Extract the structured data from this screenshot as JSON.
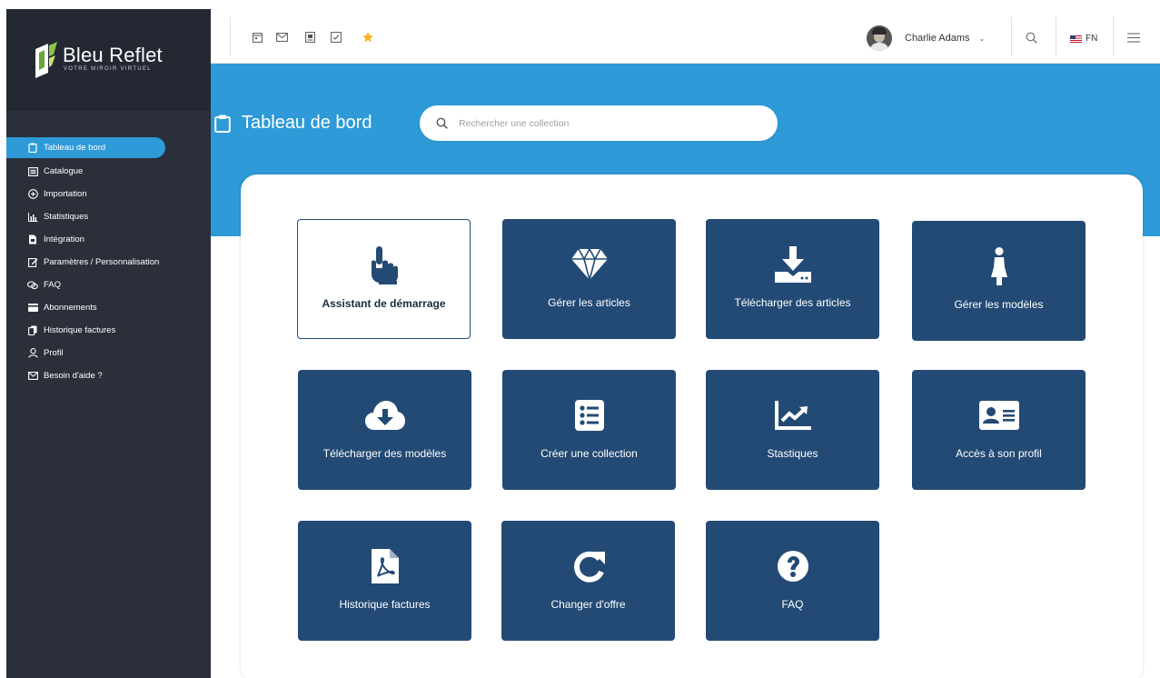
{
  "brand": {
    "name": "Bleu Reflet",
    "tagline": "VOTRE MIROIR VIRTUEL"
  },
  "sidebar": {
    "items": [
      {
        "label": "Tableau de bord",
        "icon": "clipboard-icon",
        "active": true
      },
      {
        "label": "Catalogue",
        "icon": "catalog-icon"
      },
      {
        "label": "Importation",
        "icon": "import-icon"
      },
      {
        "label": "Statistiques",
        "icon": "bar-chart-icon"
      },
      {
        "label": "Intégration",
        "icon": "document-icon"
      },
      {
        "label": "Paramètres / Personnalisation",
        "icon": "edit-icon"
      },
      {
        "label": "FAQ",
        "icon": "chat-icon"
      },
      {
        "label": "Abonnements",
        "icon": "credit-card-icon"
      },
      {
        "label": "Historique factures",
        "icon": "copy-icon"
      },
      {
        "label": "Profil",
        "icon": "user-icon"
      },
      {
        "label": "Besoin d'aide ?",
        "icon": "mail-icon"
      }
    ]
  },
  "topbar": {
    "user_name": "Charlie Adams",
    "language": "FN"
  },
  "header": {
    "title": "Tableau de bord",
    "search_placeholder": "Rechercher une collection"
  },
  "tiles": [
    {
      "label": "Assistant de démarrage",
      "icon": "pointing-hand-icon",
      "style": "outline"
    },
    {
      "label": "Gérer les articles",
      "icon": "diamond-icon"
    },
    {
      "label": "Télécharger des articles",
      "icon": "download-tray-icon"
    },
    {
      "label": "Gérer les modèles",
      "icon": "female-figure-icon"
    },
    {
      "label": "Télécharger des modèles",
      "icon": "cloud-download-icon"
    },
    {
      "label": "Créer une collection",
      "icon": "list-icon"
    },
    {
      "label": "Stastiques",
      "icon": "trend-chart-icon"
    },
    {
      "label": "Accès à son profil",
      "icon": "id-card-icon"
    },
    {
      "label": "Historique factures",
      "icon": "pdf-file-icon"
    },
    {
      "label": "Changer d'offre",
      "icon": "refresh-icon"
    },
    {
      "label": "FAQ",
      "icon": "question-circle-icon"
    }
  ],
  "colors": {
    "sidebar_bg": "#2a2f3a",
    "accent_blue": "#2e9ad7",
    "tile_navy": "#234a74",
    "star": "#f5b21b"
  }
}
